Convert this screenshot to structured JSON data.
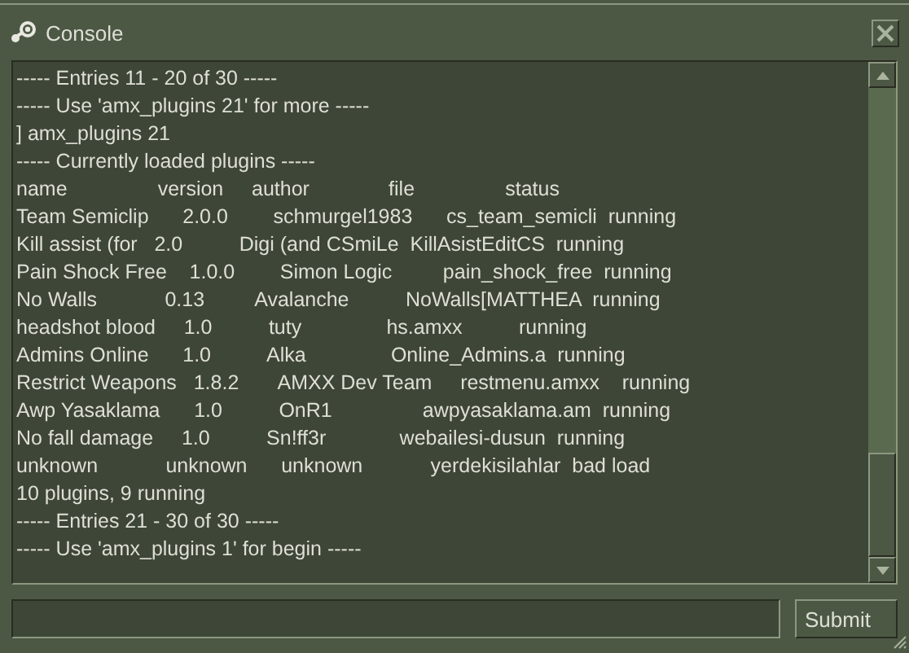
{
  "window": {
    "title": "Console"
  },
  "console": {
    "lines": [
      "----- Entries 11 - 20 of 30 -----",
      "----- Use 'amx_plugins 21' for more -----",
      "] amx_plugins 21",
      "----- Currently loaded plugins -----",
      "name                version     author              file                status",
      "Team Semiclip      2.0.0        schmurgel1983      cs_team_semicli  running",
      "Kill assist (for   2.0          Digi (and CSmiLe  KillAsistEditCS  running",
      "Pain Shock Free    1.0.0        Simon Logic         pain_shock_free  running",
      "No Walls            0.13         Avalanche          NoWalls[MATTHEA  running",
      "headshot blood     1.0          tuty               hs.amxx          running",
      "Admins Online      1.0          Alka               Online_Admins.a  running",
      "Restrict Weapons   1.8.2       AMXX Dev Team     restmenu.amxx    running",
      "Awp Yasaklama      1.0          OnR1                awpyasaklama.am  running",
      "No fall damage     1.0          Sn!ff3r             webailesi-dusun  running",
      "unknown            unknown      unknown            yerdekisilahlar  bad load",
      "10 plugins, 9 running",
      "----- Entries 21 - 30 of 30 -----",
      "----- Use 'amx_plugins 1' for begin -----"
    ]
  },
  "buttons": [
    "Submit"
  ]
}
